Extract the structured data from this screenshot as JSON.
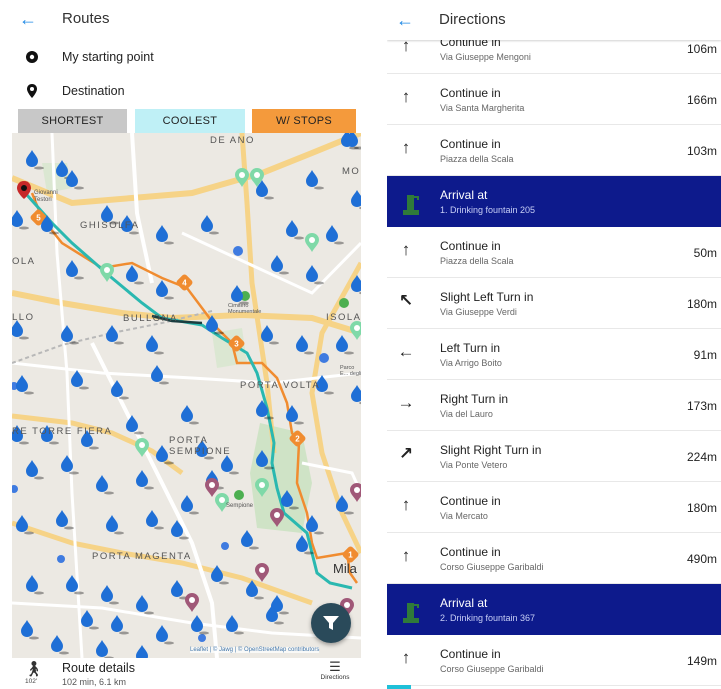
{
  "routes_panel": {
    "back_icon": "arrow-left-icon",
    "title": "Routes",
    "starting_point": "My starting point",
    "destination": "Destination",
    "modes": [
      "SHORTEST",
      "COOLEST",
      "W/ STOPS"
    ],
    "colors": {
      "shortest": "#c8c8c8",
      "coolest": "#bff0f6",
      "stops": "#f49a3c",
      "coolest_route": "#2ab8b0",
      "stops_route": "#f08c30",
      "water_marker": "#1f6fd6",
      "accent": "#1e88e5"
    },
    "map": {
      "districts": [
        "GHISOLFA",
        "BULLONA",
        "PORTA VOLTA",
        "PORTA SEMPIONE",
        "PORTA MAGENTA",
        "ISOLA",
        "Mila",
        "OLA",
        "LLO",
        "RE TORRE FIERA",
        "DE ANO",
        "MON",
        "Giovanni Testori",
        "Cimitero Monumentale",
        "Parco E... degli",
        "Sempione"
      ],
      "stop_numbers": [
        "5",
        "4",
        "3",
        "2",
        "1"
      ],
      "attribution": "Leaflet | © Jawg | © OpenStreetMap contributors"
    },
    "filter_icon": "filter-icon",
    "route_details": {
      "title": "Route details",
      "summary": "102 min, 6.1 km",
      "temperature": "102'",
      "walker_icon": "walking-person-icon",
      "directions_label": "Directions",
      "directions_icon": "list-icon"
    }
  },
  "directions_panel": {
    "back_icon": "arrow-left-icon",
    "title": "Directions",
    "steps": [
      {
        "type": "straight",
        "instruction": "Continue in",
        "street": "Via Giuseppe Mengoni",
        "distance": "106m"
      },
      {
        "type": "straight",
        "instruction": "Continue in",
        "street": "Via Santa Margherita",
        "distance": "166m"
      },
      {
        "type": "straight",
        "instruction": "Continue in",
        "street": "Piazza della Scala",
        "distance": "103m"
      },
      {
        "type": "arrival",
        "instruction": "Arrival at",
        "street": "1. Drinking fountain 205",
        "distance": ""
      },
      {
        "type": "straight",
        "instruction": "Continue in",
        "street": "Piazza della Scala",
        "distance": "50m"
      },
      {
        "type": "slight-left",
        "instruction": "Slight Left Turn in",
        "street": "Via Giuseppe Verdi",
        "distance": "180m"
      },
      {
        "type": "left",
        "instruction": "Left Turn in",
        "street": "Via Arrigo Boito",
        "distance": "91m"
      },
      {
        "type": "right",
        "instruction": "Right Turn in",
        "street": "Via del Lauro",
        "distance": "173m"
      },
      {
        "type": "slight-right",
        "instruction": "Slight Right Turn in",
        "street": "Via Ponte Vetero",
        "distance": "224m"
      },
      {
        "type": "straight",
        "instruction": "Continue in",
        "street": "Via Mercato",
        "distance": "180m"
      },
      {
        "type": "straight",
        "instruction": "Continue in",
        "street": "Corso Giuseppe Garibaldi",
        "distance": "490m"
      },
      {
        "type": "arrival",
        "instruction": "Arrival at",
        "street": "2. Drinking fountain 367",
        "distance": ""
      },
      {
        "type": "straight",
        "instruction": "Continue in",
        "street": "Corso Giuseppe Garibaldi",
        "distance": "149m"
      }
    ],
    "arrival_color": "#0d1a8c"
  }
}
